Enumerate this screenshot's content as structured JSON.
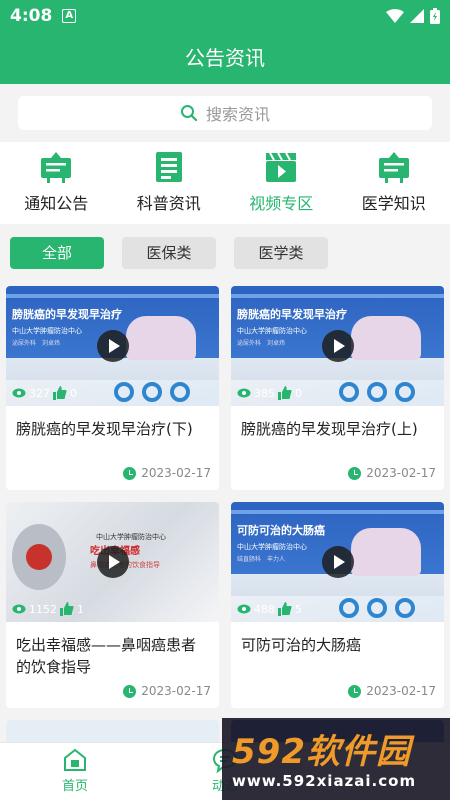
{
  "status": {
    "time": "4:08",
    "notif_letter": "A"
  },
  "header": {
    "title": "公告资讯"
  },
  "search": {
    "placeholder": "搜索资讯"
  },
  "categories": [
    {
      "label": "通知公告",
      "icon": "announcement-board-icon"
    },
    {
      "label": "科普资讯",
      "icon": "newspaper-icon"
    },
    {
      "label": "视频专区",
      "icon": "video-clapper-icon",
      "active": true
    },
    {
      "label": "医学知识",
      "icon": "medical-board-icon"
    }
  ],
  "filters": [
    {
      "label": "全部",
      "active": true
    },
    {
      "label": "医保类"
    },
    {
      "label": "医学类"
    }
  ],
  "cards": [
    {
      "thumb_title": "膀胱癌的早发现早治疗",
      "thumb_sub": "中山大学肿瘤防治中心",
      "thumb_sub2": "泌尿外科　刘卓炜",
      "views": "327",
      "likes": "0",
      "title": "膀胱癌的早发现早治疗(下)",
      "date": "2023-02-17"
    },
    {
      "thumb_title": "膀胱癌的早发现早治疗",
      "thumb_sub": "中山大学肿瘤防治中心",
      "thumb_sub2": "泌尿外科　刘卓炜",
      "views": "385",
      "likes": "0",
      "title": "膀胱癌的早发现早治疗(上)",
      "date": "2023-02-17"
    },
    {
      "thumb_title": "吃出幸福感",
      "thumb_sub": "中山大学肿瘤防治中心",
      "thumb_sub2": "鼻咽癌患者的饮食指导",
      "views": "1152",
      "likes": "1",
      "title": "吃出幸福感——鼻咽癌患者的饮食指导",
      "date": "2023-02-17"
    },
    {
      "thumb_title": "可防可治的大肠癌",
      "thumb_sub": "中山大学肿瘤防治中心",
      "thumb_sub2": "结直肠科　丰力人",
      "views": "488",
      "likes": "5",
      "title": "可防可治的大肠癌",
      "date": "2023-02-17"
    }
  ],
  "tabbar": [
    {
      "label": "首页",
      "icon": "home-icon"
    },
    {
      "label": "动态",
      "icon": "chat-bubble-icon"
    }
  ],
  "watermark": {
    "brand": "592软件园",
    "url": "www.592xiazai.com"
  },
  "colors": {
    "primary": "#27b56f",
    "thumb_blue": "#2f6fc6"
  }
}
